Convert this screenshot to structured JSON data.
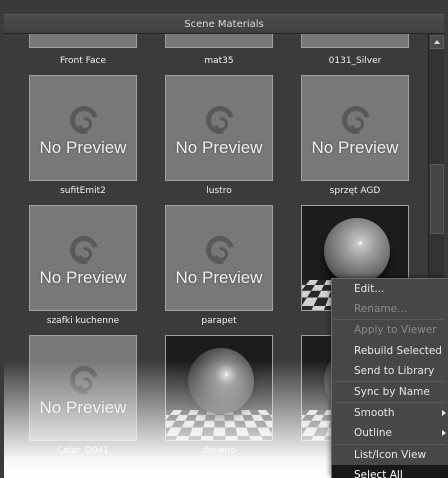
{
  "window": {
    "title": "Scene Materials"
  },
  "rows": [
    {
      "tiles": [
        {
          "label": "Front Face",
          "preview": "partial"
        },
        {
          "label": "mat35",
          "preview": "partial"
        },
        {
          "label": "0131_Silver",
          "preview": "partial"
        }
      ]
    },
    {
      "tiles": [
        {
          "label": "sufitEmit2",
          "preview": "none",
          "preview_text": "No Preview"
        },
        {
          "label": "lustro",
          "preview": "none",
          "preview_text": "No Preview"
        },
        {
          "label": "sprzęt AGD",
          "preview": "none",
          "preview_text": "No Preview"
        }
      ]
    },
    {
      "tiles": [
        {
          "label": "szafki kuchenne",
          "preview": "none",
          "preview_text": "No Preview"
        },
        {
          "label": "parapet",
          "preview": "none",
          "preview_text": "No Preview"
        },
        {
          "label": "",
          "preview": "sphere-glass"
        }
      ]
    },
    {
      "tiles": [
        {
          "label": "Color_D041",
          "preview": "none",
          "preview_text": "No Preview"
        },
        {
          "label": "drewno",
          "preview": "sphere"
        },
        {
          "label": "",
          "preview": "sphere"
        }
      ]
    }
  ],
  "context_menu": {
    "items": [
      {
        "label": "Edit...",
        "enabled": true
      },
      {
        "label": "Rename...",
        "enabled": false
      },
      {
        "separator": true
      },
      {
        "label": "Apply to Viewer",
        "enabled": false
      },
      {
        "label": "Rebuild Selected",
        "enabled": true
      },
      {
        "label": "Send to Library",
        "enabled": true
      },
      {
        "separator": true
      },
      {
        "label": "Sync by Name",
        "enabled": true
      },
      {
        "separator": true
      },
      {
        "label": "Smooth",
        "enabled": true,
        "submenu": true
      },
      {
        "label": "Outline",
        "enabled": true,
        "submenu": true
      },
      {
        "separator": true
      },
      {
        "label": "List/Icon View",
        "enabled": true
      },
      {
        "label": "Select All",
        "enabled": true,
        "selected": true
      }
    ]
  },
  "colors": {
    "panel": "#3b3b3b",
    "tile": "#787878",
    "menu": "#474747",
    "highlight": "#181818"
  }
}
